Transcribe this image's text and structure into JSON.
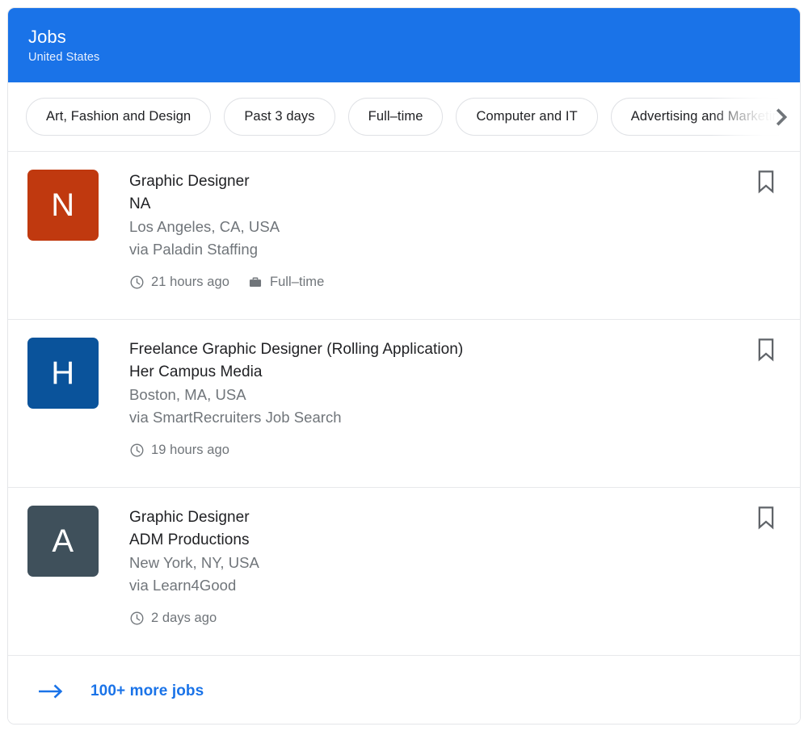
{
  "header": {
    "title": "Jobs",
    "subtitle": "United States",
    "background_color": "#1a73e8"
  },
  "filters": {
    "chips": [
      {
        "label": "Art, Fashion and Design"
      },
      {
        "label": "Past 3 days"
      },
      {
        "label": "Full–time"
      },
      {
        "label": "Computer and IT"
      },
      {
        "label": "Advertising and Marketing"
      }
    ],
    "next_icon": "chevron-right-icon"
  },
  "jobs": [
    {
      "logo_letter": "N",
      "logo_color": "#c0390f",
      "title": "Graphic Designer",
      "company": "NA",
      "location": "Los Angeles, CA, USA",
      "via": "via Paladin Staffing",
      "posted": "21 hours ago",
      "employment_type": "Full–time",
      "posted_icon": "clock-icon",
      "type_icon": "briefcase-icon",
      "bookmark_icon": "bookmark-icon"
    },
    {
      "logo_letter": "H",
      "logo_color": "#0a539b",
      "title": "Freelance Graphic Designer (Rolling Application)",
      "company": "Her Campus Media",
      "location": "Boston, MA, USA",
      "via": "via SmartRecruiters Job Search",
      "posted": "19 hours ago",
      "employment_type": "",
      "posted_icon": "clock-icon",
      "type_icon": "",
      "bookmark_icon": "bookmark-icon"
    },
    {
      "logo_letter": "A",
      "logo_color": "#3f505b",
      "title": "Graphic Designer",
      "company": "ADM Productions",
      "location": "New York, NY, USA",
      "via": "via Learn4Good",
      "posted": "2 days ago",
      "employment_type": "",
      "posted_icon": "clock-icon",
      "type_icon": "",
      "bookmark_icon": "bookmark-icon"
    }
  ],
  "footer": {
    "label": "100+ more jobs",
    "arrow_icon": "arrow-right-icon",
    "link_color": "#1a73e8"
  }
}
